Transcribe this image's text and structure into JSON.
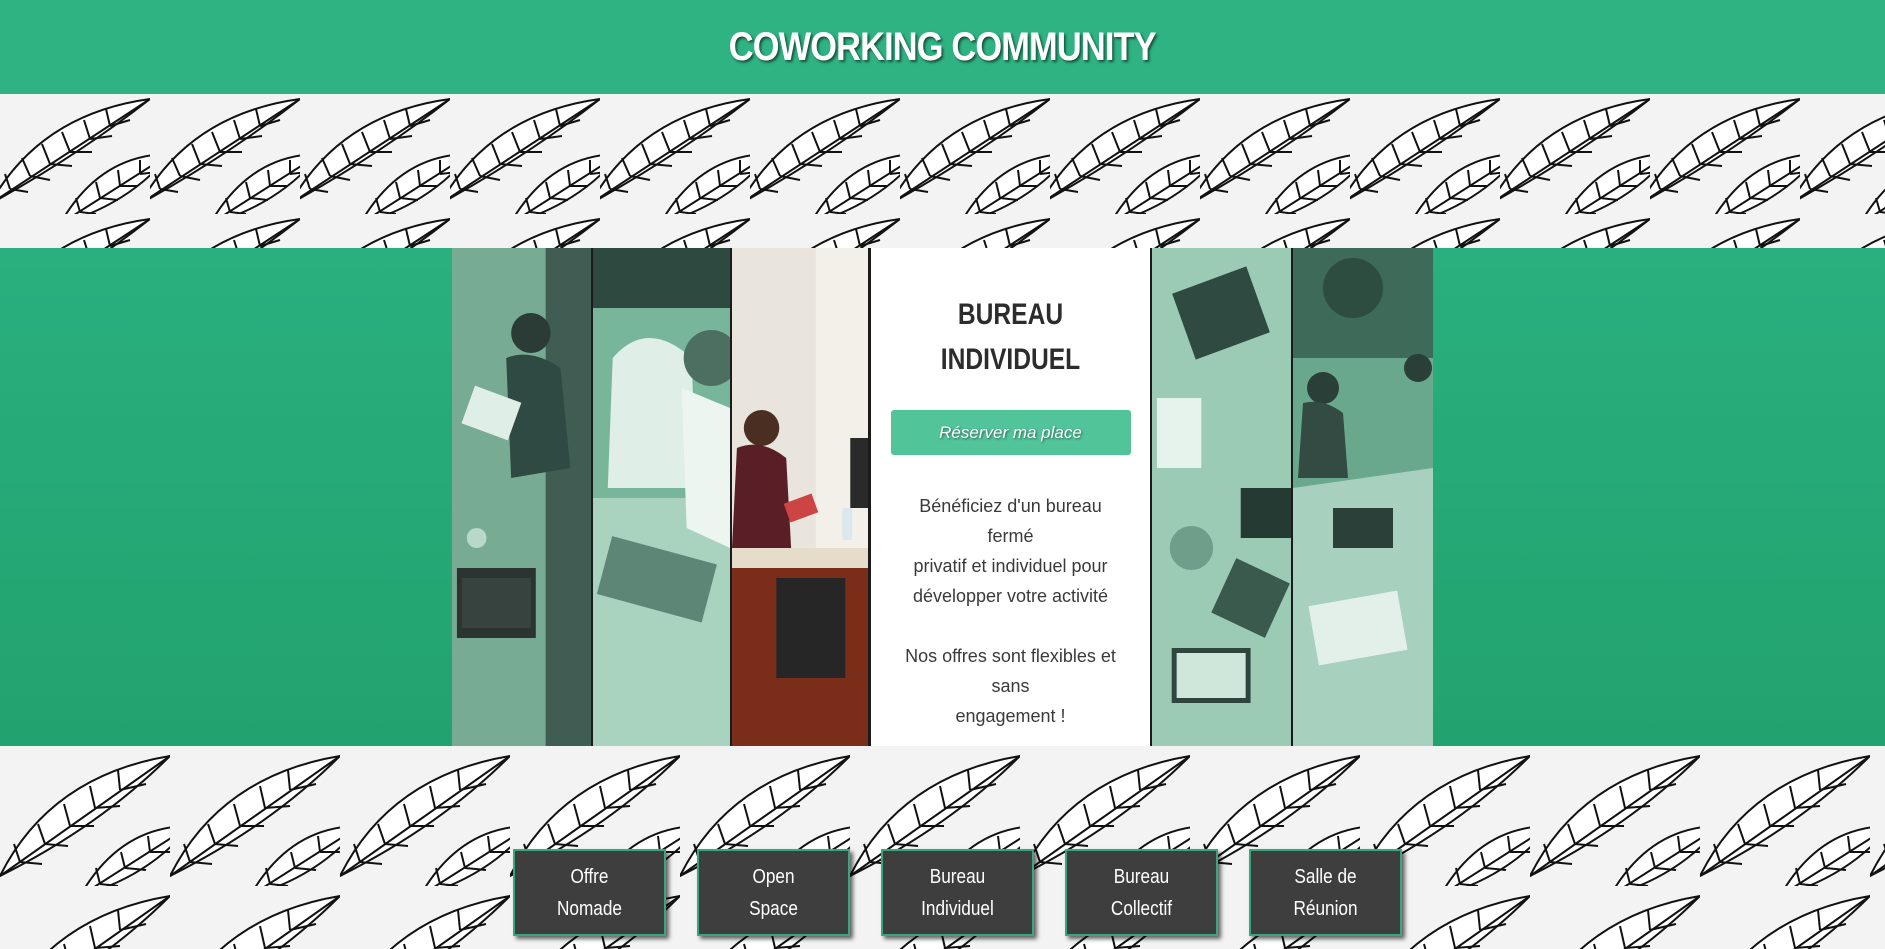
{
  "header": {
    "title": "COWORKING COMMUNITY"
  },
  "card": {
    "title_line1": "BUREAU",
    "title_line2": "INDIVIDUEL",
    "button_label": "Réserver ma place",
    "desc1_line1": "Bénéficiez d'un bureau fermé",
    "desc1_line2": "privatif et individuel pour",
    "desc1_line3": "développer votre activité",
    "desc2_line1": "Nos offres sont flexibles et sans",
    "desc2_line2": "engagement !"
  },
  "nav": [
    {
      "line1": "Offre",
      "line2": "Nomade"
    },
    {
      "line1": "Open",
      "line2": "Space"
    },
    {
      "line1": "Bureau",
      "line2": "Individuel"
    },
    {
      "line1": "Bureau",
      "line2": "Collectif"
    },
    {
      "line1": "Salle de",
      "line2": "Réunion"
    }
  ],
  "colors": {
    "brand_green": "#2fb382",
    "button_green": "#52c49a",
    "nav_dark": "#3e3e3e"
  }
}
